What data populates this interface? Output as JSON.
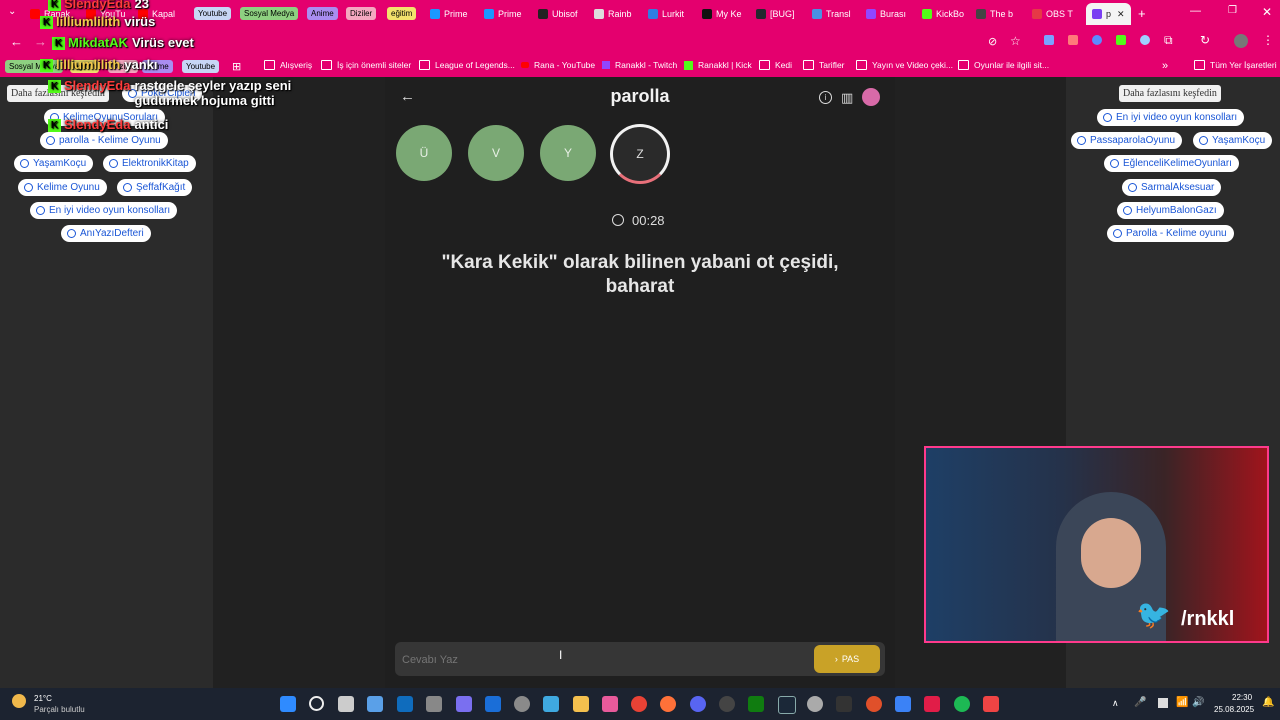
{
  "tabs": [
    {
      "label": "Ranak",
      "color": "#ff0000"
    },
    {
      "label": "YouTu",
      "color": "#ff0000"
    },
    {
      "label": "Kapal",
      "color": "#ff0000"
    },
    {
      "label": "Prime",
      "color": "#1a98ff"
    },
    {
      "label": "Prime",
      "color": "#1a98ff"
    },
    {
      "label": "Ubisof",
      "color": "#222222"
    },
    {
      "label": "Rainb",
      "color": "#dddddd"
    },
    {
      "label": "Lurkit",
      "color": "#2f7de1"
    },
    {
      "label": "My Ke",
      "color": "#111111"
    },
    {
      "label": "[BUG]",
      "color": "#24292f"
    },
    {
      "label": "Transl",
      "color": "#4a90e2"
    },
    {
      "label": "Burası",
      "color": "#9146ff"
    },
    {
      "label": "KickBo",
      "color": "#53fc18"
    },
    {
      "label": "The b",
      "color": "#444444"
    },
    {
      "label": "OBS T",
      "color": "#e63946"
    },
    {
      "label": "p",
      "color": "#7a3ff2"
    }
  ],
  "tab_groups": [
    {
      "label": "Youtube",
      "color": "#c7d6f5"
    },
    {
      "label": "Sosyal Medya",
      "color": "#8ed081"
    },
    {
      "label": "Anime",
      "color": "#a98df0"
    },
    {
      "label": "Diziler",
      "color": "#f4a8c0"
    },
    {
      "label": "eğitim",
      "color": "#f2e26c"
    }
  ],
  "bookmarks": [
    "Sosyal Medya",
    "eğitim",
    "Diziler",
    "Anime",
    "Youtube",
    "Alışveriş",
    "İş için önemli siteler",
    "League of Legends...",
    "Rana - YouTube",
    "Ranakkl - Twitch",
    "Ranakkl | Kick",
    "Kedi",
    "Tarifler",
    "Yayın ve Video çeki...",
    "Oyunlar ile ilgili sit...",
    "Tüm Yer İşaretleri"
  ],
  "chat": [
    {
      "user": "SlendyEda",
      "msg": "23",
      "user_color": "#ff3b3b"
    },
    {
      "user": "lilliumlilith",
      "msg": "virüs",
      "user_color": "#f2c94c"
    },
    {
      "user": "MikdatAK",
      "msg": "Virüs evet",
      "user_color": "#53fc18"
    },
    {
      "user": "lilliumlilith",
      "msg": "yankı",
      "user_color": "#f2c94c"
    },
    {
      "user": "SlendyEda",
      "msg": "rastgele şeyler yazıp seni gudurmek hojuma gitti",
      "user_color": "#ff3b3b"
    },
    {
      "user": "SlendyEda",
      "msg": "antici",
      "user_color": "#ff3b3b"
    }
  ],
  "left_panel": {
    "discover": "Daha fazlasını keşfedin",
    "chips": [
      "PokerCipleri",
      "KelimeOyunuSoruları",
      "parolla - Kelime Oyunu",
      "YaşamKoçu",
      "ElektronikKitap",
      "Kelime Oyunu",
      "ŞeffafKağıt",
      "En iyi video oyun konsolları",
      "AnıYazıDefteri"
    ]
  },
  "right_panel": {
    "discover": "Daha fazlasını keşfedin",
    "chips": [
      "En iyi video oyun konsolları",
      "PassaparolaOyunu",
      "YaşamKoçu",
      "EğlenceliKelimeOyunları",
      "SarmalAksesuar",
      "HelyumBalonGazı",
      "Parolla - Kelime oyunu"
    ]
  },
  "game": {
    "title": "parolla",
    "letters": [
      "Ü",
      "V",
      "Y",
      "Z"
    ],
    "timer": "00:28",
    "question": "\"Kara Kekik\" olarak bilinen yabani ot çeşidi, baharat",
    "answer_placeholder": "Cevabı Yaz",
    "pass_label": "PAS"
  },
  "webcam": {
    "handle": "/rnkkl"
  },
  "taskbar": {
    "weather_temp": "21°C",
    "weather_desc": "Parçalı bulutlu",
    "time": "22:30",
    "date": "25.08.2025"
  },
  "colors": {
    "browser_accent": "#e4006e",
    "letter_done": "#7aa874",
    "pass_button": "#c9a227"
  }
}
